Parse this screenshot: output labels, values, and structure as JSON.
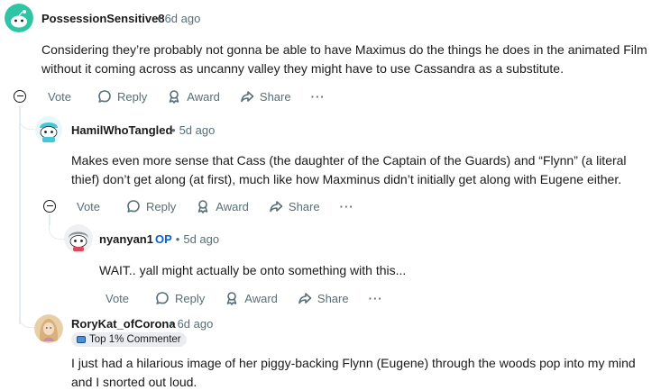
{
  "comments": [
    {
      "username": "PossessionSensitive8",
      "time": "6d ago",
      "body": "Considering they’re probably not gonna be able to have Maximus do the things he does in the animated Film without it coming across as uncanny valley they might have to use Cassandra as a substitute.",
      "avatar_color": "#2ec4a4"
    },
    {
      "username": "HamilWhoTangled",
      "time": "5d ago",
      "body": "Makes even more sense that Cass (the daughter of the Captain of the Guards) and “Flynn” (a literal thief) don’t get along (at first), much like how Maxminus didn’t initially get along with Eugene either.",
      "avatar_color": "#46c7d6"
    },
    {
      "username": "nyanyan1",
      "op_label": "OP",
      "time": "5d ago",
      "body": "WAIT.. yall might actually be onto something with this...",
      "avatar_color": "#cfd3d6"
    },
    {
      "username": "RoryKat_ofCorona",
      "time": "6d ago",
      "flair": "Top 1% Commenter",
      "body": "I just had a hilarious image of her piggy-backing Flynn (Eugene) through the woods pop into my mind and I snorted out loud.",
      "avatar_color": "#e9cfa8"
    }
  ],
  "actions": {
    "vote": "Vote",
    "reply": "Reply",
    "award": "Award",
    "share": "Share",
    "more": "···"
  },
  "meta": {
    "separator": "•"
  },
  "colors": {
    "text": "#1a1a1b",
    "meta": "#576f76",
    "op": "#0a5fd6",
    "thread": "#e5ebee"
  }
}
